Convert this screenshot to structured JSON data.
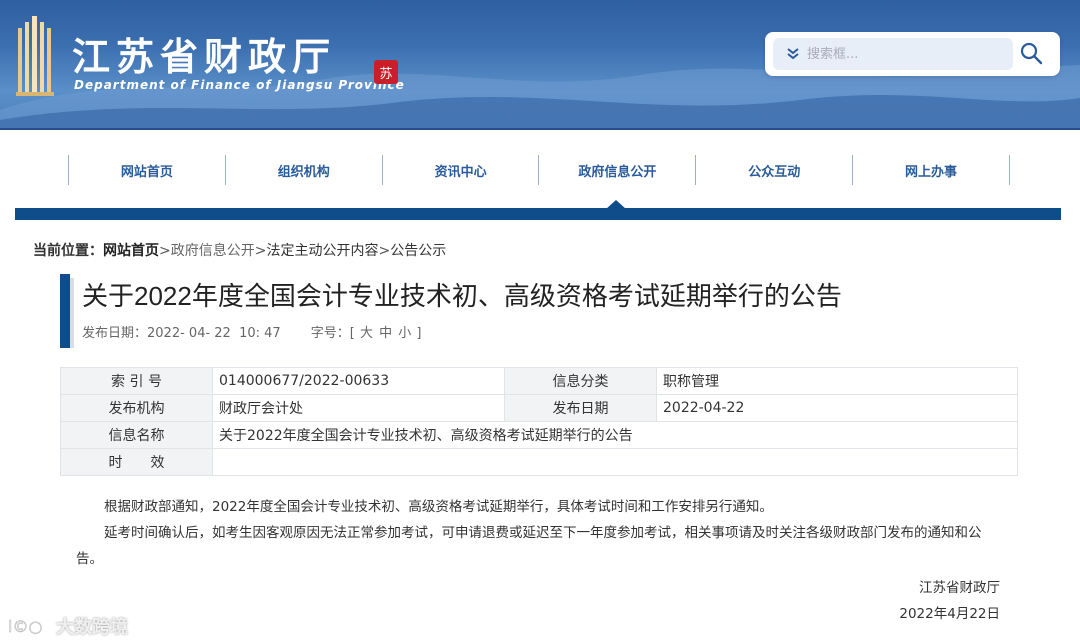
{
  "header": {
    "title": "江苏省财政厅",
    "subtitle": "Department of Finance of Jiangsu Province",
    "seal": "苏",
    "search_placeholder": "搜索框..."
  },
  "nav": {
    "items": [
      {
        "label": "网站首页"
      },
      {
        "label": "组织机构"
      },
      {
        "label": "资讯中心"
      },
      {
        "label": "政府信息公开"
      },
      {
        "label": "公众互动"
      },
      {
        "label": "网上办事"
      }
    ]
  },
  "breadcrumb": {
    "label": "当前位置：",
    "home": "网站首页",
    "sep": ">",
    "level1": "政府信息公开",
    "level2": "法定主动公开内容",
    "current": "公告公示"
  },
  "article": {
    "title": "关于2022年度全国会计专业技术初、高级资格考试延期举行的公告",
    "date_label": "发布日期：",
    "date_value": "2022- 04- 22  10: 47",
    "font_label": "字号：",
    "font_open": "[",
    "font_large": "大",
    "font_medium": "中",
    "font_small": "小",
    "font_close": "]"
  },
  "info": {
    "index_key": "索 引 号",
    "index_value": "014000677/2022-00633",
    "category_key": "信息分类",
    "category_value": "职称管理",
    "org_key": "发布机构",
    "org_value": "财政厅会计处",
    "pubdate_key": "发布日期",
    "pubdate_value": "2022-04-22",
    "name_key": "信息名称",
    "name_value": "关于2022年度全国会计专业技术初、高级资格考试延期举行的公告",
    "validity_key": "时　　效",
    "validity_value": ""
  },
  "body": {
    "p1": "根据财政部通知，2022年度全国会计专业技术初、高级资格考试延期举行，具体考试时间和工作安排另行通知。",
    "p2": "延考时间确认后，如考生因客观原因无法正常参加考试，可申请退费或延迟至下一年度参加考试，相关事项请及时关注各级财政部门发布的通知和公告。",
    "signer": "江苏省财政厅",
    "sign_date": "2022年4月22日"
  },
  "watermark": {
    "text": "大数跨境"
  },
  "colors": {
    "brand_blue": "#0f4c8a",
    "nav_text": "#2a5b9a",
    "seal_red": "#c8202a"
  },
  "icons": {
    "search": "magnifier",
    "chevron": "double-chevron-down",
    "logo": "building-columns"
  }
}
